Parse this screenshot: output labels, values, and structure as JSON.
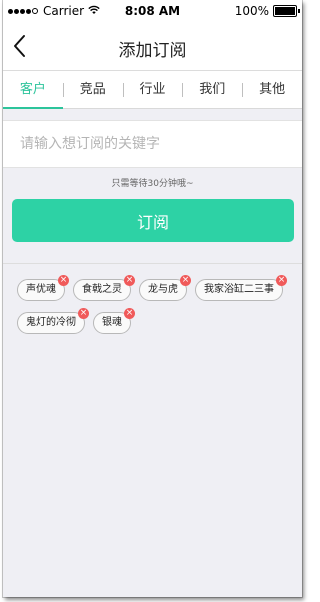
{
  "status_bar": {
    "carrier": "Carrier",
    "time": "8:08 AM",
    "battery": "100%",
    "signal_icon": "signal-dots-icon",
    "wifi_icon": "wifi-icon",
    "battery_icon": "battery-icon"
  },
  "navbar": {
    "title": "添加订阅",
    "back_icon": "chevron-left-icon"
  },
  "tabs": [
    {
      "label": "客户",
      "active": true
    },
    {
      "label": "竞品",
      "active": false
    },
    {
      "label": "行业",
      "active": false
    },
    {
      "label": "我们",
      "active": false
    },
    {
      "label": "其他",
      "active": false
    }
  ],
  "search": {
    "placeholder": "请输入想订阅的关键字",
    "value": ""
  },
  "hint": "只需等待30分钟哦~",
  "subscribe_button": "订阅",
  "tags": [
    {
      "label": "声优魂",
      "remove": "×"
    },
    {
      "label": "食戟之灵",
      "remove": "×"
    },
    {
      "label": "龙与虎",
      "remove": "×"
    },
    {
      "label": "我家浴缸二三事",
      "remove": "×"
    },
    {
      "label": "鬼灯的冷彻",
      "remove": "×"
    },
    {
      "label": "银魂",
      "remove": "×"
    }
  ],
  "colors": {
    "accent": "#2cc49b",
    "button": "#2dd2a5",
    "remove_badge": "#f05a5a",
    "background": "#efeff4"
  }
}
